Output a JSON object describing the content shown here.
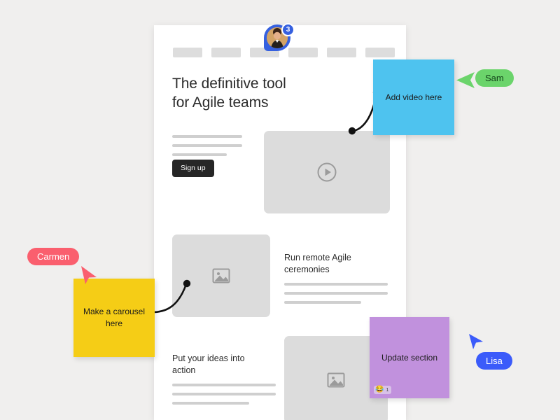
{
  "canvas": {
    "background_color": "#f0efee"
  },
  "page": {
    "nav_placeholders": 6,
    "headline": "The definitive tool\nfor Agile teams",
    "signup_button": "Sign up",
    "hero_video_placeholder_icon": "play-circle-icon",
    "sections": [
      {
        "image_icon": "image-placeholder-icon",
        "title": "Run remote Agile\nceremonies"
      },
      {
        "title": "Put your ideas into\naction",
        "image_icon": "image-placeholder-icon"
      }
    ]
  },
  "avatar_pin": {
    "badge_count": "3",
    "ring_color": "#3560df",
    "badge_color": "#3560df"
  },
  "stickies": [
    {
      "id": "blue",
      "text": "Add video here",
      "color": "#4ec3ef"
    },
    {
      "id": "yellow",
      "text": "Make a carousel here",
      "color": "#f5cd16"
    },
    {
      "id": "purple",
      "text": "Update section",
      "color": "#c191dd",
      "reaction": {
        "emoji": "😂",
        "count": "1"
      }
    }
  ],
  "collaborators": [
    {
      "name": "Sam",
      "color": "#6bd46b",
      "text_color": "#13441a"
    },
    {
      "name": "Carmen",
      "color": "#fa5f6e",
      "text_color": "#ffffff"
    },
    {
      "name": "Lisa",
      "color": "#3b5bfa",
      "text_color": "#ffffff"
    }
  ]
}
